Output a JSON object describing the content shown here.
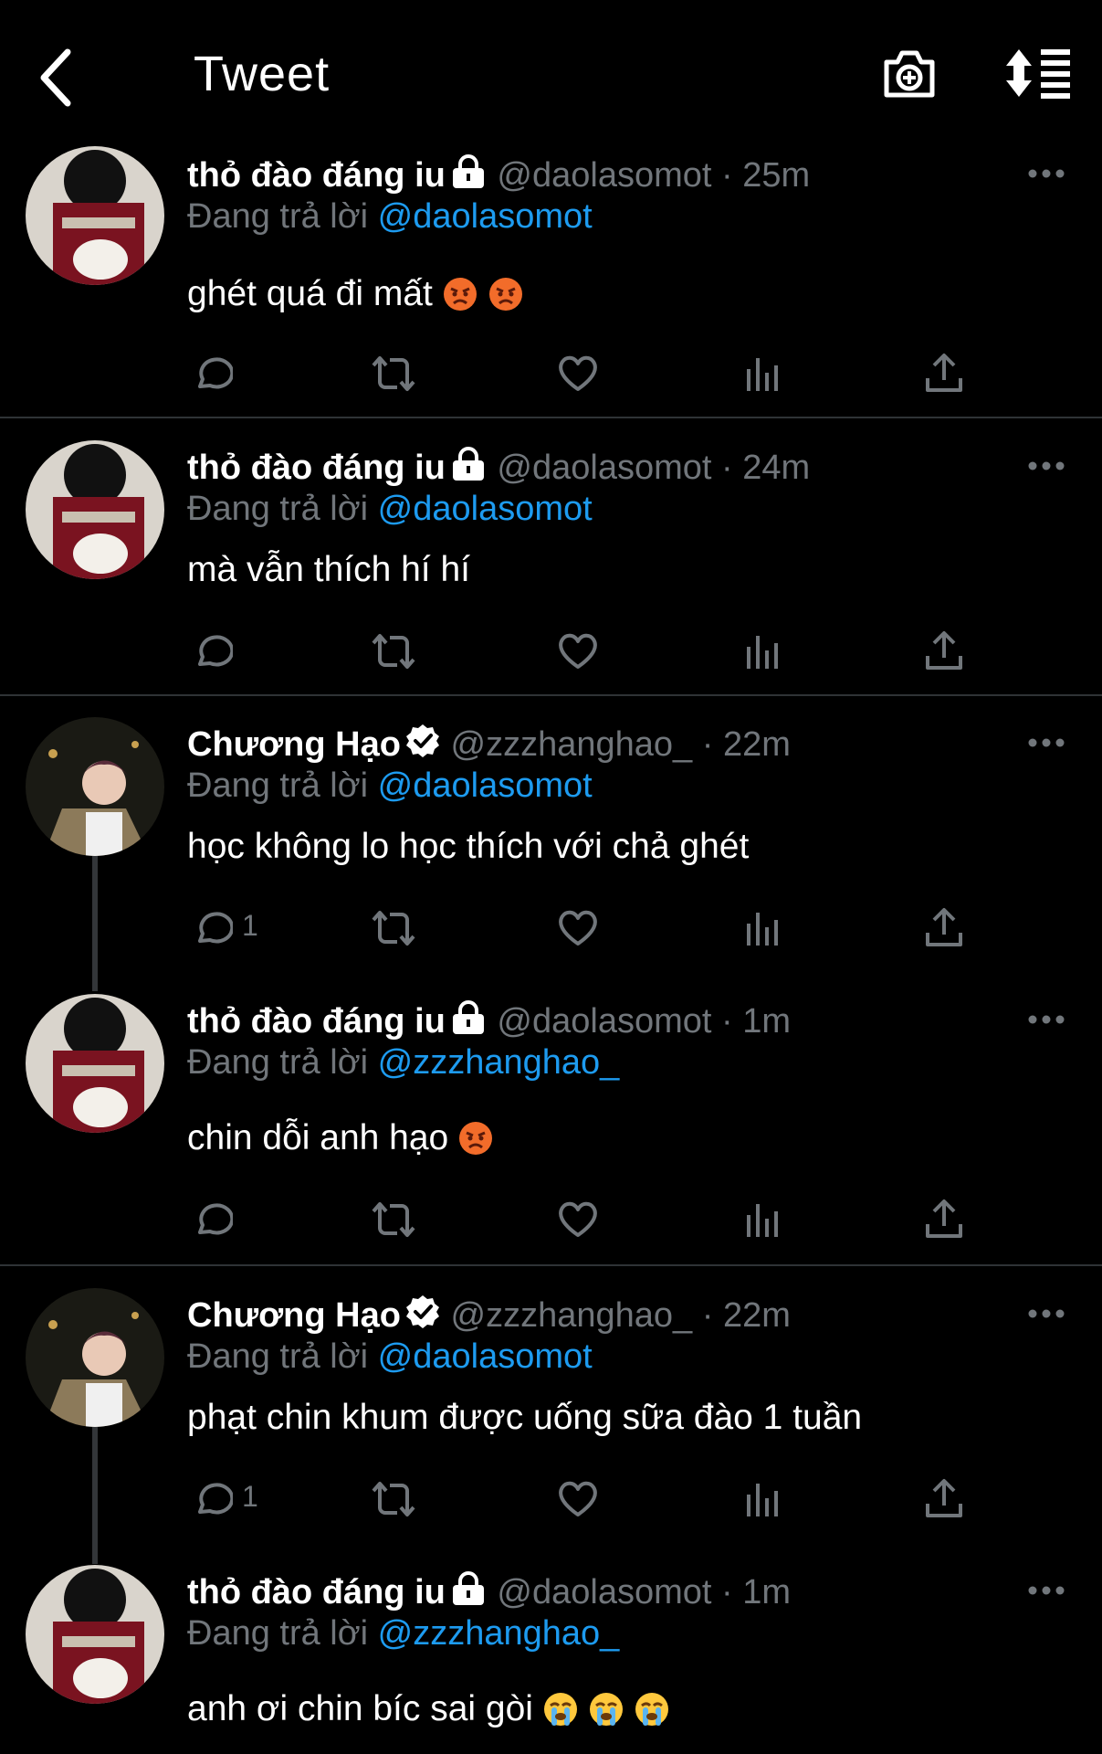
{
  "header": {
    "title": "Tweet",
    "back_icon": "chevron-left-icon",
    "camera_icon": "add-photo-icon",
    "sort_icon": "sort-icon"
  },
  "colors": {
    "background": "#000000",
    "text": "#ffffff",
    "muted": "#71767b",
    "link": "#1d9bf0",
    "divider": "#2f3336"
  },
  "tweets": [
    {
      "name": "thỏ đào đáng iu",
      "badge": "lock-icon",
      "handle": "@daolasomot",
      "time": "· 25m",
      "reply_prefix": "Đang trả lời",
      "reply_to": "@daolasomot",
      "text": "ghét quá đi mất",
      "emojis": [
        "angry-face-icon",
        "angry-face-icon"
      ],
      "reply_count": ""
    },
    {
      "name": "thỏ đào đáng iu",
      "badge": "lock-icon",
      "handle": "@daolasomot",
      "time": "· 24m",
      "reply_prefix": "Đang trả lời",
      "reply_to": "@daolasomot",
      "text": "mà vẫn thích hí hí",
      "emojis": [],
      "reply_count": ""
    },
    {
      "name": "Chương Hạo",
      "badge": "verified-icon",
      "handle": "@zzzhanghao_",
      "time": "· 22m",
      "reply_prefix": "Đang trả lời",
      "reply_to": "@daolasomot",
      "text": "học không lo học thích với chả ghét",
      "emojis": [],
      "reply_count": "1"
    },
    {
      "name": "thỏ đào đáng iu",
      "badge": "lock-icon",
      "handle": "@daolasomot",
      "time": "· 1m",
      "reply_prefix": "Đang trả lời",
      "reply_to": "@zzzhanghao_",
      "text": "chin dỗi anh hạo",
      "emojis": [
        "angry-face-icon"
      ],
      "reply_count": ""
    },
    {
      "name": "Chương Hạo",
      "badge": "verified-icon",
      "handle": "@zzzhanghao_",
      "time": "· 22m",
      "reply_prefix": "Đang trả lời",
      "reply_to": "@daolasomot",
      "text": "phạt chin khum được uống sữa đào 1 tuần",
      "emojis": [],
      "reply_count": "1"
    },
    {
      "name": "thỏ đào đáng iu",
      "badge": "lock-icon",
      "handle": "@daolasomot",
      "time": "· 1m",
      "reply_prefix": "Đang trả lời",
      "reply_to": "@zzzhanghao_",
      "text": "anh ơi chin bíc sai gòi",
      "emojis": [
        "crying-face-icon",
        "crying-face-icon",
        "crying-face-icon"
      ],
      "reply_count": ""
    }
  ]
}
